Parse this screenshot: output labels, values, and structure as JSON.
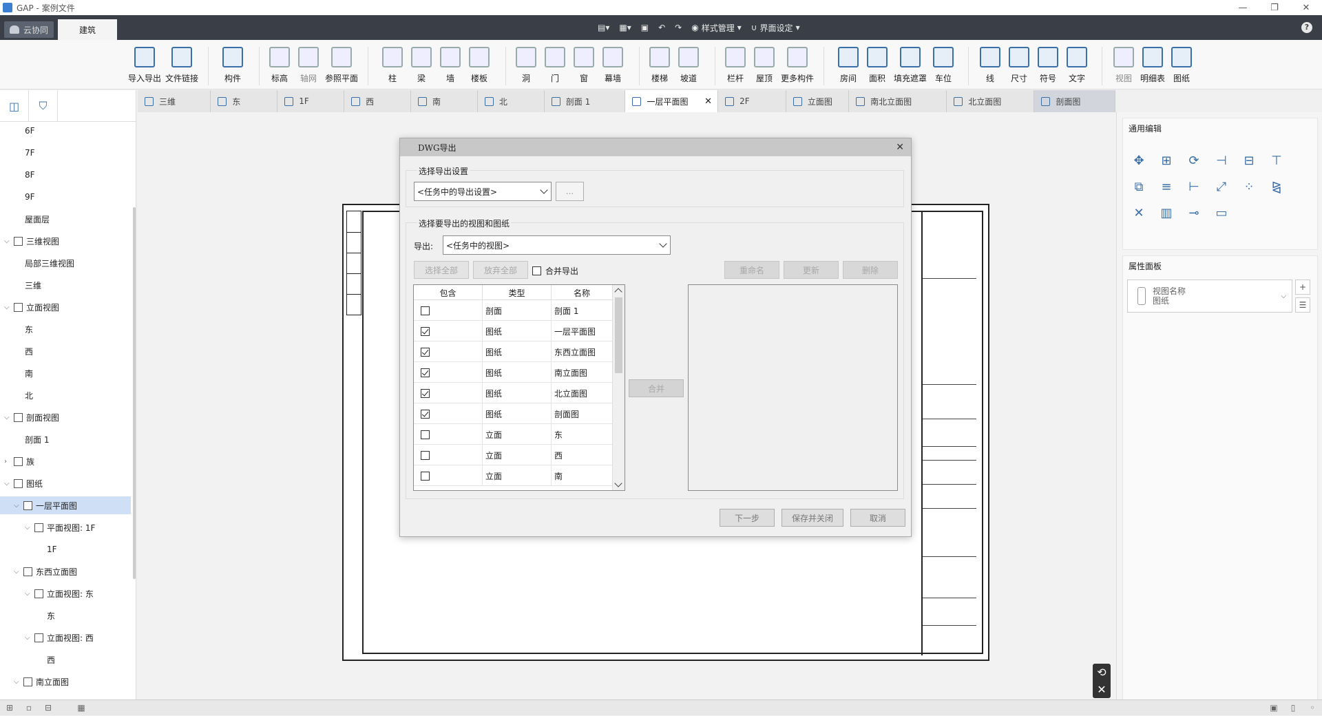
{
  "window": {
    "title": "GAP - 案例文件",
    "minimize": "—",
    "restore": "❐",
    "close": "✕"
  },
  "menubar": {
    "cloud_tab": "云协同",
    "build_tab": "建筑",
    "qat": {
      "style_manage": "样式管理",
      "ui_settings": "界面设定"
    },
    "help": "?"
  },
  "ribbon": {
    "import_export": "导入导出",
    "file_link": "文件链接",
    "component": "构件",
    "elevation": "标高",
    "axis_grid": "轴网",
    "ref_plane": "参照平面",
    "column": "柱",
    "beam": "梁",
    "wall": "墙",
    "floor_slab": "楼板",
    "opening": "洞",
    "door": "门",
    "window": "窗",
    "curtain_wall": "幕墙",
    "stairs": "楼梯",
    "ramp": "坡道",
    "railing": "栏杆",
    "roof": "屋顶",
    "more_components": "更多构件",
    "room": "房间",
    "area": "面积",
    "fill_mask": "填充遮罩",
    "parking": "车位",
    "line": "线",
    "dimension": "尺寸",
    "symbol": "符号",
    "text": "文字",
    "view": "视图",
    "schedule": "明细表",
    "sheet": "图纸"
  },
  "tree": {
    "items": [
      "6F",
      "7F",
      "8F",
      "9F",
      "屋面层",
      "三维视图",
      "局部三维视图",
      "三维",
      "立面视图",
      "东",
      "西",
      "南",
      "北",
      "剖面视图",
      "剖面 1",
      "族",
      "图纸",
      "一层平面图",
      "平面视图: 1F",
      "1F",
      "东西立面图",
      "立面视图: 东",
      "东",
      "立面视图: 西",
      "西",
      "南立面图"
    ]
  },
  "tabs": [
    "三维",
    "东",
    "1F",
    "西",
    "南",
    "北",
    "剖面 1",
    "一层平面图",
    "2F",
    "立面图",
    "南北立面图",
    "北立面图",
    "剖面图"
  ],
  "right_panel": {
    "edit_title": "通用编辑",
    "props_title": "属性面板",
    "view_name_label": "视图名称",
    "view_name_value": "图纸",
    "add": "+",
    "list": "☰"
  },
  "dialog": {
    "title": "DWG导出",
    "close": "✕",
    "group1_label": "选择导出设置",
    "setting_combo": "<任务中的导出设置>",
    "more_button": "...",
    "group2_label": "选择要导出的视图和图纸",
    "export_label": "导出:",
    "export_combo": "<任务中的视图>",
    "select_all": "选择全部",
    "deselect_all": "放弃全部",
    "merge_export": "合并导出",
    "rename": "重命名",
    "update": "更新",
    "delete": "删除",
    "merge": "合并",
    "columns": [
      "包含",
      "类型",
      "名称"
    ],
    "rows": [
      {
        "checked": false,
        "type": "剖面",
        "name": "剖面 1"
      },
      {
        "checked": true,
        "type": "图纸",
        "name": "一层平面图"
      },
      {
        "checked": true,
        "type": "图纸",
        "name": "东西立面图"
      },
      {
        "checked": true,
        "type": "图纸",
        "name": "南立面图"
      },
      {
        "checked": true,
        "type": "图纸",
        "name": "北立面图"
      },
      {
        "checked": true,
        "type": "图纸",
        "name": "剖面图"
      },
      {
        "checked": false,
        "type": "立面",
        "name": "东"
      },
      {
        "checked": false,
        "type": "立面",
        "name": "西"
      },
      {
        "checked": false,
        "type": "立面",
        "name": "南"
      }
    ],
    "next": "下一步",
    "save_close": "保存并关闭",
    "cancel": "取消"
  }
}
